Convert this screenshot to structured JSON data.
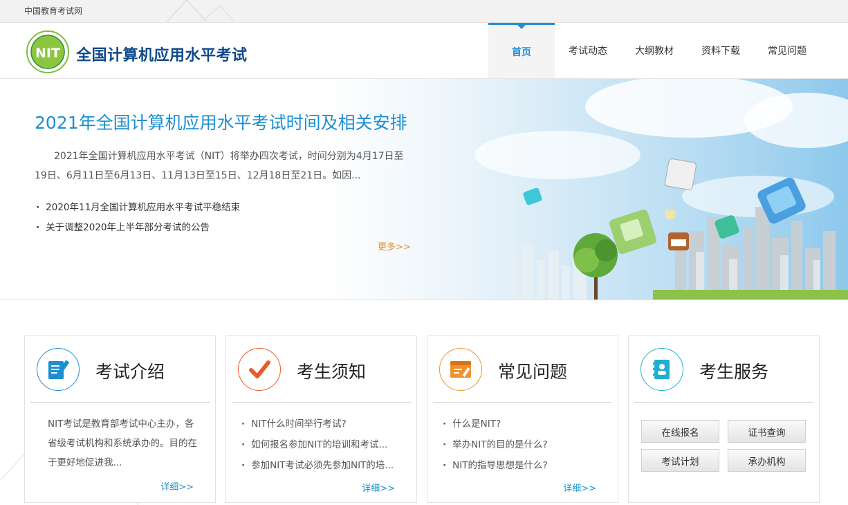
{
  "topbar": {
    "site_name": "中国教育考试网"
  },
  "header": {
    "brand": "全国计算机应用水平考试",
    "logo_text": "NIT"
  },
  "nav": [
    {
      "label": "首页",
      "active": true
    },
    {
      "label": "考试动态"
    },
    {
      "label": "大纲教材"
    },
    {
      "label": "资料下载"
    },
    {
      "label": "常见问题"
    }
  ],
  "banner": {
    "title": "2021年全国计算机应用水平考试时间及相关安排",
    "summary": "2021年全国计算机应用水平考试（NIT）将举办四次考试，时间分别为4月17日至19日、6月11日至6月13日、11月13日至15日、12月18日至21日。如因...",
    "news": [
      "2020年11月全国计算机应用水平考试平稳结束",
      "关于调整2020年上半年部分考试的公告"
    ],
    "more": "更多>>"
  },
  "cards": {
    "intro": {
      "title": "考试介绍",
      "text": "NIT考试是教育部考试中心主办，各省级考试机构和系统承办的。目的在于更好地促进我...",
      "more": "详细>>",
      "color": "#1d8fd1"
    },
    "notice": {
      "title": "考生须知",
      "items": [
        "NIT什么时间举行考试?",
        "如何报名参加NIT的培训和考试...",
        "参加NIT考试必须先参加NIT的培..."
      ],
      "more": "详细>>",
      "color": "#e95a2c"
    },
    "faq": {
      "title": "常见问题",
      "items": [
        "什么是NIT?",
        "举办NIT的目的是什么?",
        "NIT的指导思想是什么?"
      ],
      "more": "详细>>",
      "color": "#f0912f"
    },
    "service": {
      "title": "考生服务",
      "buttons": [
        "在线报名",
        "证书查询",
        "考试计划",
        "承办机构"
      ],
      "color": "#1fb0cf"
    }
  }
}
